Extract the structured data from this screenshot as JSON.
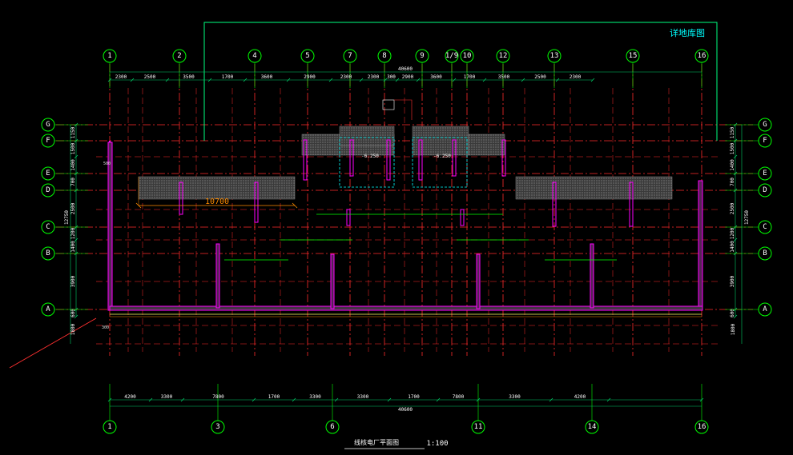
{
  "drawing": {
    "detail_title": "详地库图",
    "plan_title": "线核电厂平面图",
    "scale": "1:100"
  },
  "axes": {
    "top": [
      "1",
      "2",
      "4",
      "5",
      "7",
      "8",
      "9",
      "1/9",
      "10",
      "12",
      "13",
      "15",
      "16"
    ],
    "bottom": [
      "1",
      "3",
      "6",
      "11",
      "14",
      "16"
    ],
    "rows": [
      "G",
      "F",
      "E",
      "D",
      "C",
      "B",
      "A"
    ]
  },
  "dimensions": {
    "top_total": "40600",
    "top_segments": [
      "2300",
      "2500",
      "3500",
      "1700",
      "3600",
      "2900",
      "2300",
      "2300",
      "300",
      "2900",
      "3600",
      "1700",
      "3500",
      "2500",
      "2300"
    ],
    "bottom_total": "40600",
    "bottom_segments": [
      "4200",
      "3300",
      "7800",
      "1700",
      "3300",
      "3300",
      "1700",
      "7800",
      "3300",
      "4200"
    ],
    "left_total": "12750",
    "left_segments": [
      "1150",
      "1500",
      "1400",
      "700",
      "2500",
      "1200",
      "1400",
      "3900",
      "600"
    ],
    "left_bottom": "1800",
    "right_total": "12750",
    "right_segments": [
      "1150",
      "1500",
      "1400",
      "700",
      "2500",
      "1200",
      "1400",
      "3900",
      "600"
    ],
    "right_bottom": "1800",
    "hatch_width": "10700",
    "level_1": "-6.250",
    "level_2": "-6.250",
    "offset_500": "500",
    "offset_300": "300"
  },
  "colors": {
    "background": "#000000",
    "axis": "#ff2b2b",
    "bubble": "#00ff00",
    "wall": "#ff00ff",
    "cyan": "#00ffff",
    "green_frame": "#00ff7f",
    "leader": "#ff3030",
    "yellow": "#ffff66",
    "orange": "#ff8c00"
  }
}
